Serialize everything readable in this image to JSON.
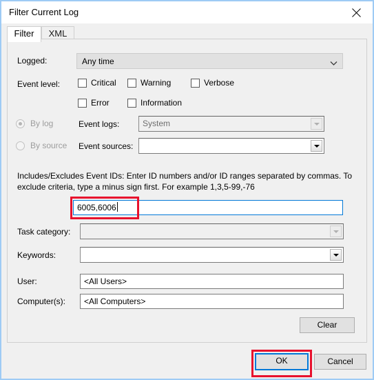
{
  "window": {
    "title": "Filter Current Log",
    "close_icon": "close-x-icon"
  },
  "tabs": [
    {
      "label": "Filter",
      "active": true
    },
    {
      "label": "XML",
      "active": false
    }
  ],
  "form": {
    "logged": {
      "label": "Logged:",
      "value": "Any time",
      "chevron_icon": "chevron-down-icon"
    },
    "event_level": {
      "label": "Event level:",
      "checkboxes": [
        {
          "label": "Critical",
          "checked": false
        },
        {
          "label": "Warning",
          "checked": false
        },
        {
          "label": "Verbose",
          "checked": false
        },
        {
          "label": "Error",
          "checked": false
        },
        {
          "label": "Information",
          "checked": false
        }
      ]
    },
    "by_log": {
      "radio_label": "By log",
      "selected": true,
      "enabled": false,
      "field_label": "Event logs:",
      "field_value": "System",
      "arrow_icon": "dropdown-arrow-icon"
    },
    "by_source": {
      "radio_label": "By source",
      "selected": false,
      "enabled": false,
      "field_label": "Event sources:",
      "field_value": "",
      "arrow_icon": "dropdown-arrow-icon"
    },
    "event_ids": {
      "description_line1": "Includes/Excludes Event IDs: Enter ID numbers and/or ID ranges separated by commas. To",
      "description_line2": "exclude criteria, type a minus sign first. For example 1,3,5-99,-76",
      "value": "6005,6006",
      "focused": true
    },
    "task_category": {
      "label": "Task category:",
      "value": "",
      "enabled": false,
      "arrow_icon": "dropdown-arrow-icon"
    },
    "keywords": {
      "label": "Keywords:",
      "value": "",
      "enabled": true,
      "arrow_icon": "dropdown-arrow-icon"
    },
    "user": {
      "label": "User:",
      "value": "<All Users>"
    },
    "computers": {
      "label": "Computer(s):",
      "value": "<All Computers>"
    },
    "clear_button": "Clear"
  },
  "footer": {
    "ok_button": "OK",
    "cancel_button": "Cancel"
  },
  "annotations": {
    "accent_color": "#e8112d",
    "focus_color": "#0078d7",
    "highlighted": [
      "event-ids-input",
      "ok-button"
    ]
  }
}
